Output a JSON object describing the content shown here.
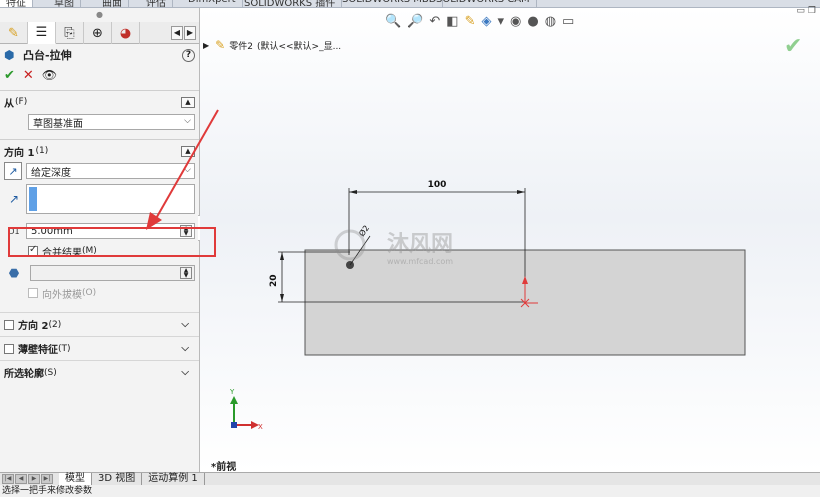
{
  "ribbon": {
    "tabs": [
      "特征",
      "草图",
      "曲面",
      "评估",
      "DimXpert",
      "SOLIDWORKS 插件",
      "SOLIDWORKS MBD",
      "SOLIDWORKS CAM"
    ]
  },
  "feature_tree": {
    "part_name": "零件2",
    "config_text": "(默认<<默认>_显..."
  },
  "property_manager": {
    "title": "凸台-拉伸",
    "help_symbol": "?",
    "from": {
      "label": "从",
      "key": "(F)",
      "value": "草图基准面"
    },
    "direction1": {
      "label": "方向 1",
      "key": "(1)",
      "end_condition": "给定深度",
      "depth": "5.00mm",
      "merge_result": "合并结果",
      "merge_key": "(M)",
      "merge_checked": true,
      "draft_outward": "向外拔模",
      "draft_key": "(O)"
    },
    "direction2": {
      "label": "方向 2",
      "key": "(2)"
    },
    "thin_feature": {
      "label": "薄壁特征",
      "key": "(T)"
    },
    "selected_contours": {
      "label": "所选轮廓",
      "key": "(S)"
    }
  },
  "sketch": {
    "dim_width": "100",
    "dim_height": "20",
    "dim_diameter": "Ø2"
  },
  "triad": {
    "x": "X",
    "y": "Y"
  },
  "view_name": "*前视",
  "watermark": {
    "brand": "沐风网",
    "url": "www.mfcad.com"
  },
  "bottom_tabs": [
    "模型",
    "3D 视图",
    "运动算例 1"
  ],
  "status_text": "选择一把手来修改参数",
  "colors": {
    "highlight": "#e03a3a",
    "ok": "#2c9a2c",
    "cancel": "#c82020",
    "selection_fill": "#5fa0e6"
  }
}
